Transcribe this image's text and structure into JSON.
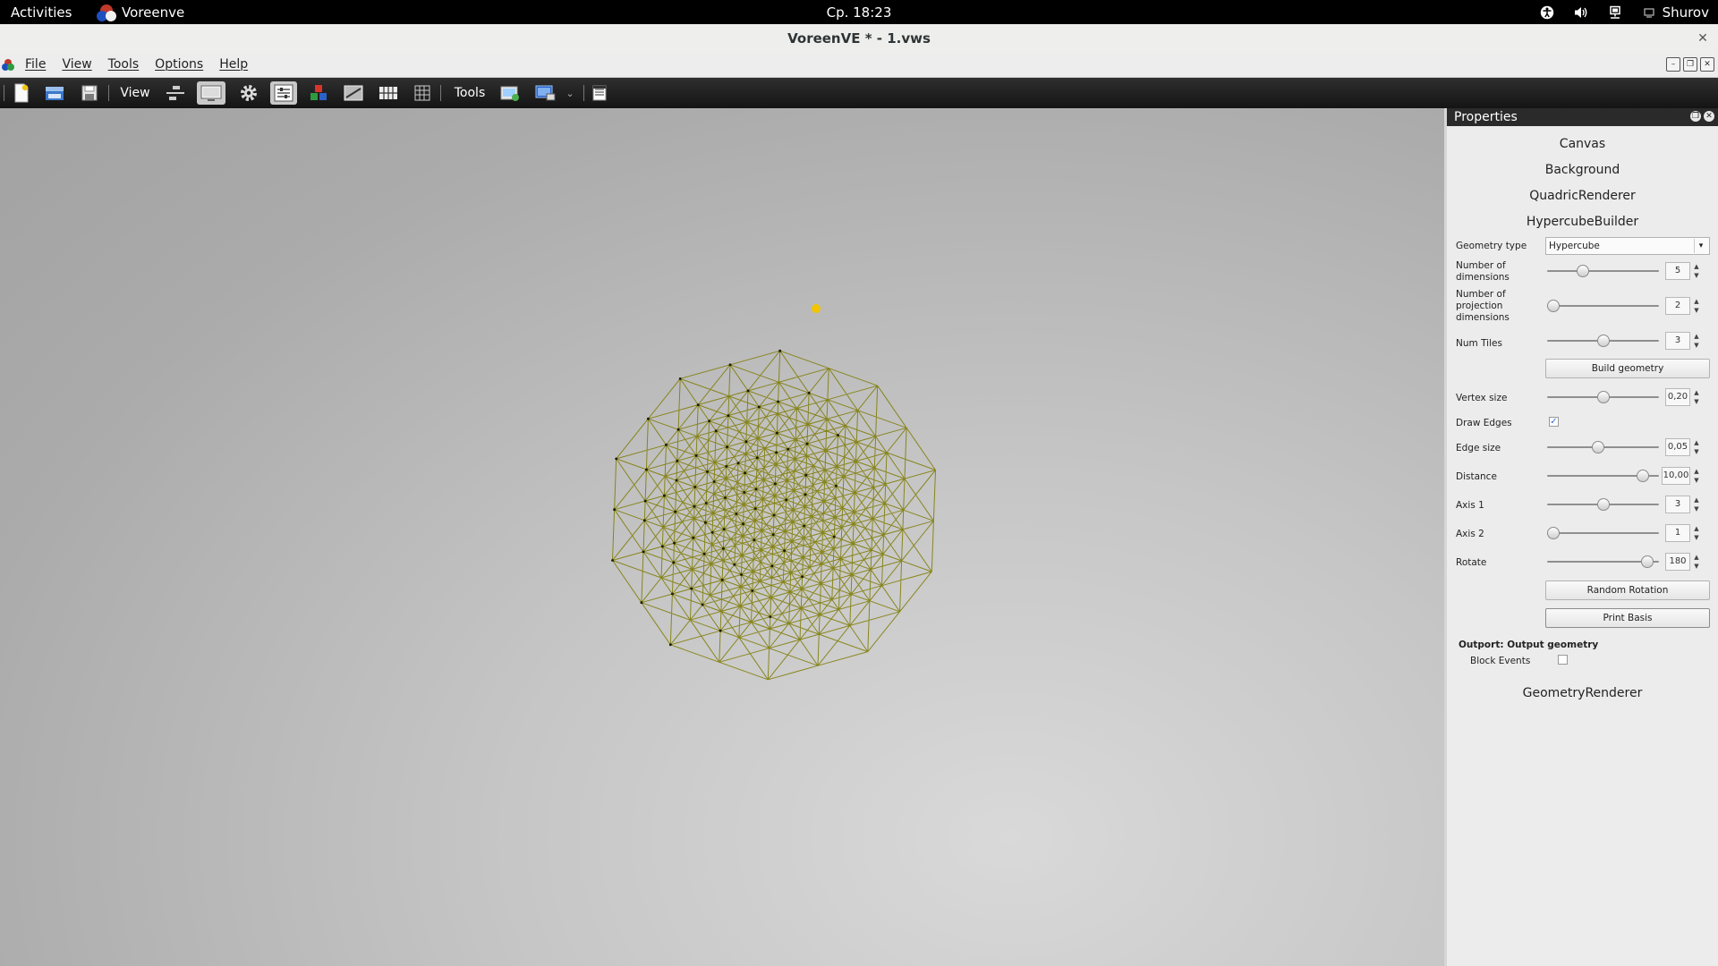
{
  "topbar": {
    "activities": "Activities",
    "app_name": "Voreenve",
    "clock": "Ср. 18:23",
    "user": "Shurov"
  },
  "window": {
    "title": "VoreenVE * - 1.vws",
    "close_glyph": "✕"
  },
  "menu": {
    "file": "File",
    "view": "View",
    "tools": "Tools",
    "options": "Options",
    "help": "Help"
  },
  "toolbar": {
    "view_label": "View",
    "tools_label": "Tools"
  },
  "properties": {
    "title": "Properties",
    "processors": {
      "canvas": "Canvas",
      "background": "Background",
      "quadric": "QuadricRenderer",
      "hypercube": "HypercubeBuilder",
      "geometry_renderer": "GeometryRenderer"
    },
    "geometry_type": {
      "label": "Geometry type",
      "value": "Hypercube"
    },
    "num_dimensions": {
      "label": "Number of dimensions",
      "value": "5",
      "level": 0.3
    },
    "num_proj_dimensions": {
      "label": "Number of projection dimensions",
      "value": "2",
      "level": 0.0
    },
    "num_tiles": {
      "label": "Num Tiles",
      "value": "3",
      "level": 0.5
    },
    "build_button": "Build geometry",
    "vertex_size": {
      "label": "Vertex size",
      "value": "0,20",
      "level": 0.5
    },
    "draw_edges": {
      "label": "Draw Edges",
      "checked": true
    },
    "edge_size": {
      "label": "Edge size",
      "value": "0,05",
      "level": 0.45
    },
    "distance": {
      "label": "Distance",
      "value": "10,00",
      "level": 0.9
    },
    "axis1": {
      "label": "Axis 1",
      "value": "3",
      "level": 0.5
    },
    "axis2": {
      "label": "Axis 2",
      "value": "1",
      "level": 0.0
    },
    "rotate": {
      "label": "Rotate",
      "value": "180",
      "level": 0.95
    },
    "random_rotation_button": "Random Rotation",
    "print_basis_button": "Print Basis",
    "outport_label": "Outport: Output geometry",
    "block_events": {
      "label": "Block Events",
      "checked": false
    }
  },
  "colors": {
    "wireframe": "#7d7a00",
    "vertex": "#1a1a00",
    "highlight_vertex": "#f2c500",
    "viewport_bg": "#b8b8b8"
  },
  "icons": {
    "accessibility": "accessibility-icon",
    "volume": "volume-icon",
    "network": "network-icon",
    "user": "user-icon"
  }
}
